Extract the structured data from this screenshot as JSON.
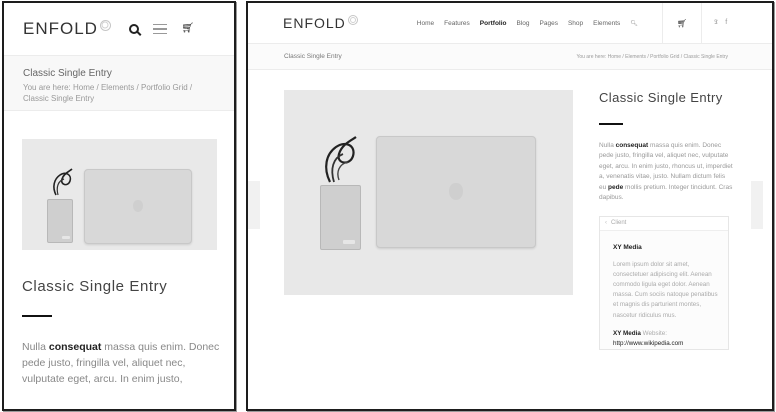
{
  "mobile": {
    "logo": "ENFOLD",
    "title_bar": {
      "title": "Classic Single Entry",
      "breadcrumb": "You are here:  Home  /  Elements  /  Portfolio Grid  /  Classic Single Entry"
    },
    "content": {
      "title": "Classic Single Entry",
      "para_pre": "Nulla ",
      "para_strong": "consequat",
      "para_post": " massa quis enim. Donec pede justo, fringilla vel, aliquet nec, vulputate eget, arcu. In enim justo,"
    }
  },
  "desktop": {
    "logo": "ENFOLD",
    "nav": [
      "Home",
      "Features",
      "Portfolio",
      "Blog",
      "Pages",
      "Shop",
      "Elements"
    ],
    "active_nav": "Portfolio",
    "title_bar": {
      "title": "Classic Single Entry",
      "breadcrumb": "You are here:  Home  /  Elements  /  Portfolio Grid  /  Classic Single Entry"
    },
    "side": {
      "title": "Classic Single Entry",
      "para_pre": "Nulla ",
      "para_strong1": "consequat",
      "para_mid": " massa quis enim. Donec pede justo, fringilla vel, aliquet nec, vulputate eget, arcu. In enim justo, rhoncus ut, imperdiet a, venenatis vitae, justo. Nullam dictum felis eu ",
      "para_strong2": "pede",
      "para_post": " mollis pretium. Integer tincidunt. Cras dapibus.",
      "box": {
        "header": "Client",
        "client_name": "XY Media",
        "lorem": "Lorem ipsum dolor sit amet, consectetuer adipiscing elit. Aenean commodo ligula eget dolor. Aenean massa. Cum sociis natoque penatibus et magnis dis parturient montes, nascetur ridiculus mus.",
        "website_company": "XY Media",
        "website_label": " Website:",
        "website_url": "http://www.wikipedia.com"
      }
    }
  },
  "colors": {
    "text_dark": "#222222",
    "text_muted": "#999999",
    "rule": "#111111",
    "titlebar_bg": "#f8f8f8"
  },
  "icons": [
    "logo-mark-icon",
    "search-icon",
    "menu-icon",
    "cart-icon",
    "twitter-icon",
    "facebook-icon",
    "chevron-left-icon",
    "chevron-right-icon",
    "apple-logo-icon"
  ]
}
